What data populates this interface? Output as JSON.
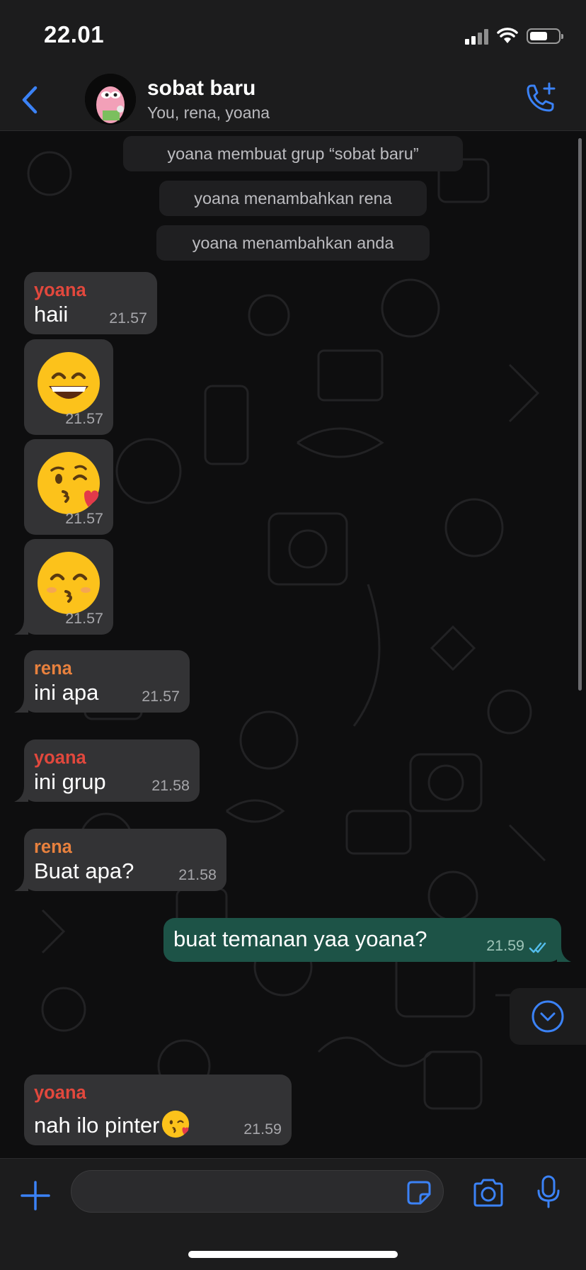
{
  "status": {
    "time": "22.01"
  },
  "header": {
    "title": "sobat baru",
    "subtitle": "You, rena, yoana"
  },
  "system_messages": [
    "yoana membuat grup “sobat baru”",
    "yoana menambahkan rena",
    "yoana menambahkan anda"
  ],
  "messages": [
    {
      "sender": "yoana",
      "text": "haii",
      "time": "21.57"
    },
    {
      "emoji": "grinning-face-with-smiling-eyes",
      "time": "21.57"
    },
    {
      "emoji": "face-blowing-a-kiss",
      "time": "21.57"
    },
    {
      "emoji": "kissing-face-with-smiling-eyes",
      "time": "21.57"
    },
    {
      "sender": "rena",
      "text": "ini apa",
      "time": "21.57"
    },
    {
      "sender": "yoana",
      "text": "ini grup",
      "time": "21.58"
    },
    {
      "sender": "rena",
      "text": "Buat apa?",
      "time": "21.58"
    },
    {
      "outgoing": true,
      "text": "buat temanan yaa yoana?",
      "time": "21.59",
      "status": "read"
    },
    {
      "sender": "yoana",
      "text": "nah ilo pinter",
      "emoji": "face-blowing-a-kiss",
      "time": "21.59"
    }
  ],
  "colors": {
    "accent": "#3b82f6",
    "sender_yoana": "#e2483d",
    "sender_rena": "#e8813e",
    "outgoing_bubble": "#1d5347",
    "incoming_bubble": "#333335"
  },
  "composer": {
    "value": "",
    "placeholder": ""
  }
}
